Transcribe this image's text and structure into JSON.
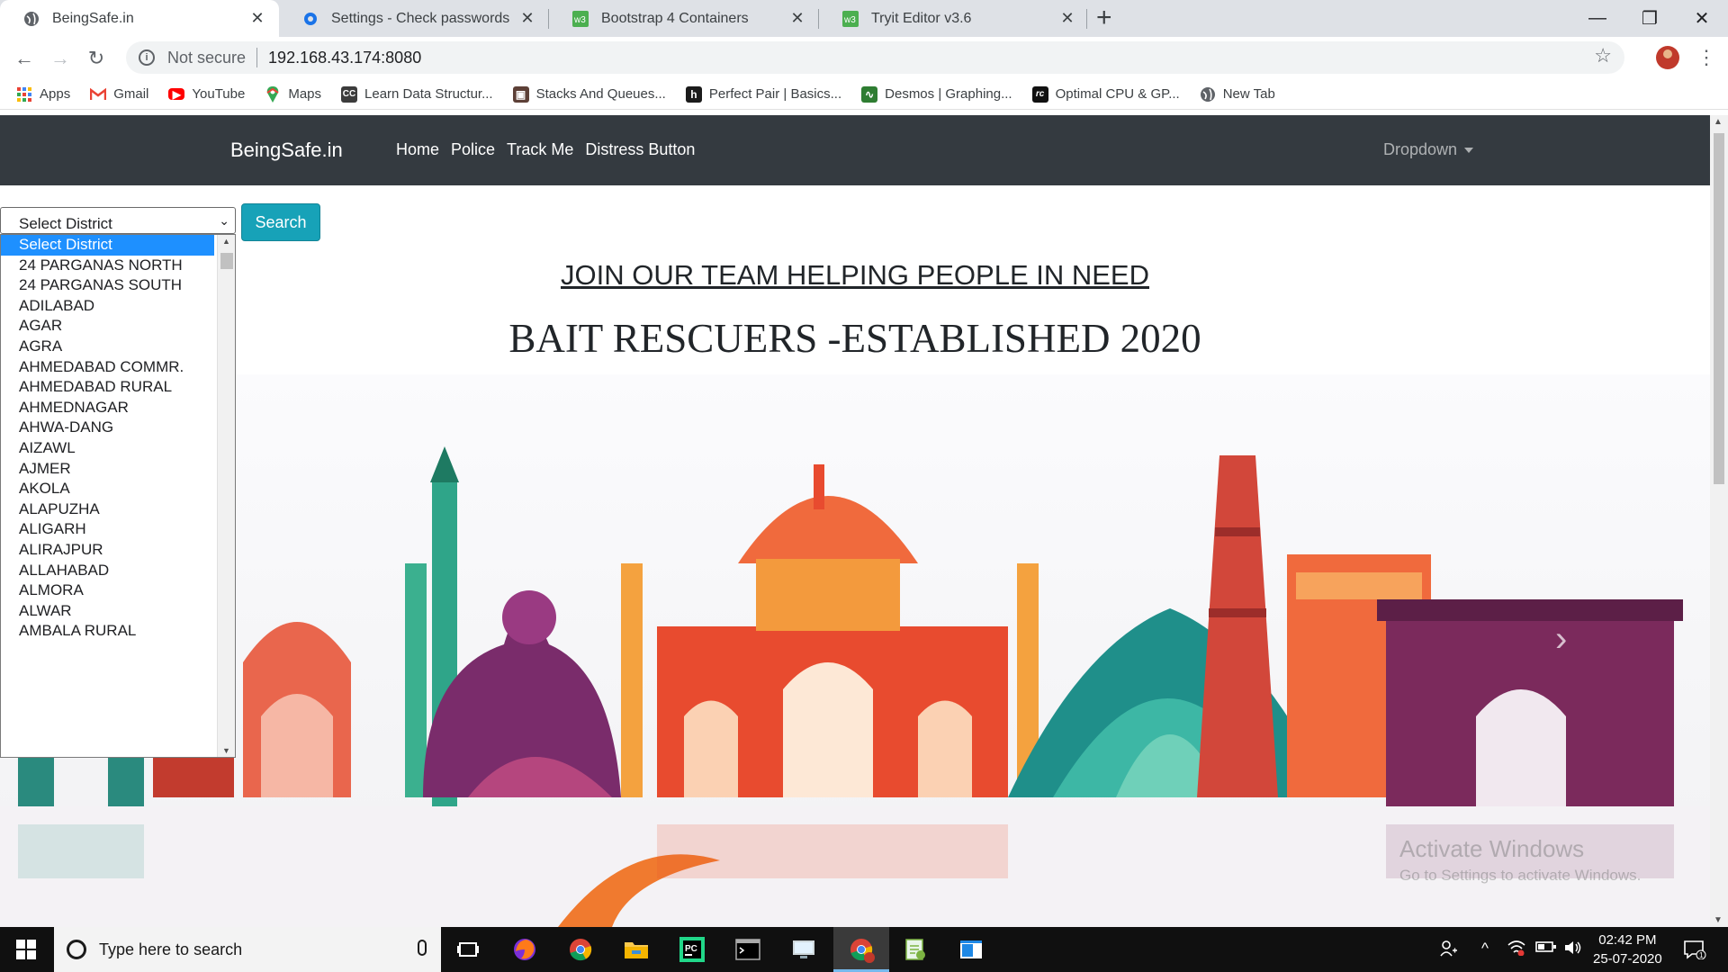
{
  "browser": {
    "tabs": [
      {
        "title": "BeingSafe.in",
        "active": true,
        "icon": "globe-icon"
      },
      {
        "title": "Settings - Check passwords",
        "active": false,
        "icon": "gear-icon"
      },
      {
        "title": "Bootstrap 4 Containers",
        "active": false,
        "icon": "w3schools-icon"
      },
      {
        "title": "Tryit Editor v3.6",
        "active": false,
        "icon": "w3schools-icon"
      }
    ],
    "not_secure": "Not secure",
    "url": "192.168.43.174:8080",
    "bookmarks": [
      {
        "label": "Apps",
        "icon": "apps-grid-icon"
      },
      {
        "label": "Gmail",
        "icon": "gmail-icon"
      },
      {
        "label": "YouTube",
        "icon": "youtube-icon"
      },
      {
        "label": "Maps",
        "icon": "maps-icon"
      },
      {
        "label": "Learn Data Structur...",
        "icon": "cc-icon"
      },
      {
        "label": "Stacks And Queues...",
        "icon": "bookmark-site-icon"
      },
      {
        "label": "Perfect Pair | Basics...",
        "icon": "hackerrank-icon"
      },
      {
        "label": "Desmos | Graphing...",
        "icon": "desmos-icon"
      },
      {
        "label": "Optimal CPU & GP...",
        "icon": "rc-icon"
      },
      {
        "label": "New Tab",
        "icon": "globe-icon"
      }
    ]
  },
  "page": {
    "brand": "BeingSafe.in",
    "nav": [
      "Home",
      "Police",
      "Track Me",
      "Distress Button"
    ],
    "dropdown": "Dropdown",
    "select_value": "Select District",
    "search_button": "Search",
    "join_heading": "JOIN OUR TEAM HELPING PEOPLE IN NEED",
    "established_heading": "BAIT RESCUERS -ESTABLISHED 2020",
    "district_options": [
      "Select District",
      "24 PARGANAS NORTH",
      "24 PARGANAS SOUTH",
      "ADILABAD",
      "AGAR",
      "AGRA",
      "AHMEDABAD COMMR.",
      "AHMEDABAD RURAL",
      "AHMEDNAGAR",
      "AHWA-DANG",
      "AIZAWL",
      "AJMER",
      "AKOLA",
      "ALAPUZHA",
      "ALIGARH",
      "ALIRAJPUR",
      "ALLAHABAD",
      "ALMORA",
      "ALWAR",
      "AMBALA RURAL"
    ],
    "selected_option_index": 0
  },
  "watermark": {
    "line1": "Activate Windows",
    "line2": "Go to Settings to activate Windows."
  },
  "taskbar": {
    "search_placeholder": "Type here to search",
    "time": "02:42 PM",
    "date": "25-07-2020",
    "notification_count": "1"
  },
  "colors": {
    "navbar": "#343a40",
    "search_button": "#17a2b8",
    "selected_option": "#1e90ff",
    "taskbar": "#101010"
  }
}
